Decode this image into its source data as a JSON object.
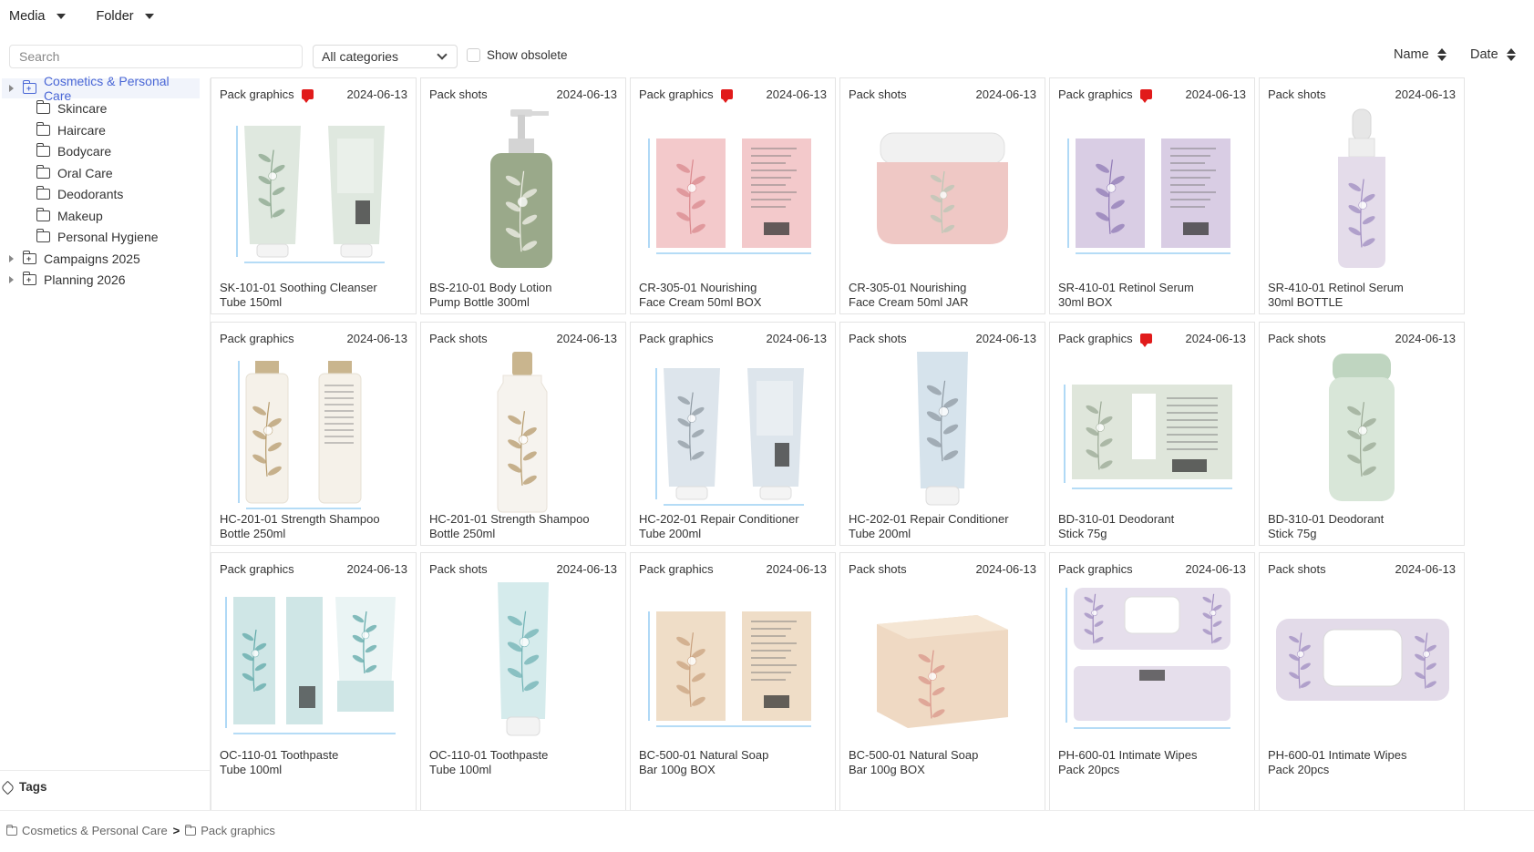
{
  "menu": {
    "media": "Media",
    "folder": "Folder"
  },
  "toolbar": {
    "search_placeholder": "Search",
    "category_selected": "All categories",
    "show_obsolete": "Show obsolete",
    "show_obsolete_checked": false,
    "sort_name": "Name",
    "sort_date": "Date"
  },
  "sidebar": {
    "tree": [
      {
        "label": "Cosmetics & Personal Care",
        "level": 0,
        "selected": true,
        "expandable": true
      },
      {
        "label": "Skincare",
        "level": 1
      },
      {
        "label": "Haircare",
        "level": 1
      },
      {
        "label": "Bodycare",
        "level": 1
      },
      {
        "label": "Oral Care",
        "level": 1
      },
      {
        "label": "Deodorants",
        "level": 1
      },
      {
        "label": "Makeup",
        "level": 1
      },
      {
        "label": "Personal Hygiene",
        "level": 1
      },
      {
        "label": "Campaigns 2025",
        "level": 0,
        "expandable": true
      },
      {
        "label": "Planning 2026",
        "level": 0,
        "expandable": true
      }
    ],
    "tags_label": "Tags"
  },
  "cards": [
    {
      "category": "Pack graphics",
      "comment": true,
      "date": "2024-06-13",
      "title1": "SK-101-01 Soothing Cleanser",
      "title2": "Tube 150ml",
      "art": "tubes-flat",
      "color": "#dfe8df",
      "accent": "#8aa58c"
    },
    {
      "category": "Pack shots",
      "comment": false,
      "date": "2024-06-13",
      "title1": "BS-210-01 Body Lotion",
      "title2": "Pump Bottle 300ml",
      "art": "pump",
      "color": "#9aa98a",
      "accent": "#f2f2ea"
    },
    {
      "category": "Pack graphics",
      "comment": true,
      "date": "2024-06-13",
      "title1": "CR-305-01 Nourishing",
      "title2": "Face Cream 50ml BOX",
      "art": "box-flat",
      "color": "#f3c9cb",
      "accent": "#d9888d"
    },
    {
      "category": "Pack shots",
      "comment": false,
      "date": "2024-06-13",
      "title1": "CR-305-01 Nourishing",
      "title2": "Face Cream 50ml JAR",
      "art": "jar",
      "color": "#efc8c5",
      "accent": "#b9c7b5"
    },
    {
      "category": "Pack graphics",
      "comment": true,
      "date": "2024-06-13",
      "title1": "SR-410-01 Retinol Serum",
      "title2": "30ml BOX",
      "art": "box-flat",
      "color": "#d9cde4",
      "accent": "#8f79b5"
    },
    {
      "category": "Pack shots",
      "comment": false,
      "date": "2024-06-13",
      "title1": "SR-410-01 Retinol Serum",
      "title2": "30ml BOTTLE",
      "art": "dropper",
      "color": "#e4dcea",
      "accent": "#9f8cc0"
    },
    {
      "category": "Pack graphics",
      "comment": false,
      "date": "2024-06-13",
      "title1": "HC-201-01 Strength Shampoo",
      "title2": "Bottle 250ml",
      "art": "bottles-flat",
      "color": "#f5f1e9",
      "accent": "#b59a6b"
    },
    {
      "category": "Pack shots",
      "comment": false,
      "date": "2024-06-13",
      "title1": "HC-201-01 Strength Shampoo",
      "title2": "Bottle 250ml",
      "art": "bottle",
      "color": "#f6f3ee",
      "accent": "#b59a6b"
    },
    {
      "category": "Pack graphics",
      "comment": false,
      "date": "2024-06-13",
      "title1": "HC-202-01 Repair Conditioner",
      "title2": "Tube 200ml",
      "art": "tubes-flat",
      "color": "#dde5ec",
      "accent": "#8f9aa3"
    },
    {
      "category": "Pack shots",
      "comment": false,
      "date": "2024-06-13",
      "title1": "HC-202-01 Repair Conditioner",
      "title2": "Tube 200ml",
      "art": "tube",
      "color": "#d6e3ec",
      "accent": "#8f9aa3"
    },
    {
      "category": "Pack graphics",
      "comment": true,
      "date": "2024-06-13",
      "title1": "BD-310-01 Deodorant",
      "title2": "Stick 75g",
      "art": "label-flat",
      "color": "#dfe6db",
      "accent": "#9aa894"
    },
    {
      "category": "Pack shots",
      "comment": false,
      "date": "2024-06-13",
      "title1": "BD-310-01 Deodorant",
      "title2": "Stick 75g",
      "art": "stick",
      "color": "#d8e6d8",
      "accent": "#9aa894"
    },
    {
      "category": "Pack graphics",
      "comment": false,
      "date": "2024-06-13",
      "title1": "OC-110-01 Toothpaste",
      "title2": "Tube 100ml",
      "art": "toothpaste-flat",
      "color": "#cfe6e6",
      "accent": "#5fa8a8"
    },
    {
      "category": "Pack shots",
      "comment": false,
      "date": "2024-06-13",
      "title1": "OC-110-01 Toothpaste",
      "title2": "Tube 100ml",
      "art": "tube",
      "color": "#d5ebec",
      "accent": "#6fb2b4"
    },
    {
      "category": "Pack graphics",
      "comment": false,
      "date": "2024-06-13",
      "title1": "BC-500-01 Natural Soap",
      "title2": "Bar 100g BOX",
      "art": "box-flat",
      "color": "#efddc7",
      "accent": "#c9a17f"
    },
    {
      "category": "Pack shots",
      "comment": false,
      "date": "2024-06-13",
      "title1": "BC-500-01 Natural Soap",
      "title2": "Bar 100g BOX",
      "art": "soapbox",
      "color": "#efd9c3",
      "accent": "#d9958a"
    },
    {
      "category": "Pack graphics",
      "comment": false,
      "date": "2024-06-13",
      "title1": "PH-600-01 Intimate Wipes",
      "title2": "Pack 20pcs",
      "art": "wipes-flat",
      "color": "#e6dfec",
      "accent": "#9f8cc0"
    },
    {
      "category": "Pack shots",
      "comment": false,
      "date": "2024-06-13",
      "title1": "PH-600-01 Intimate Wipes",
      "title2": "Pack 20pcs",
      "art": "wipes",
      "color": "#e3dbe9",
      "accent": "#9f8cc0"
    }
  ],
  "breadcrumb": {
    "root": "Cosmetics & Personal Care",
    "separator": ">",
    "current": "Pack graphics"
  },
  "colors": {
    "accent": "#4a67d6",
    "comment": "#e11b1b",
    "dimension": "#3aa0e8"
  }
}
